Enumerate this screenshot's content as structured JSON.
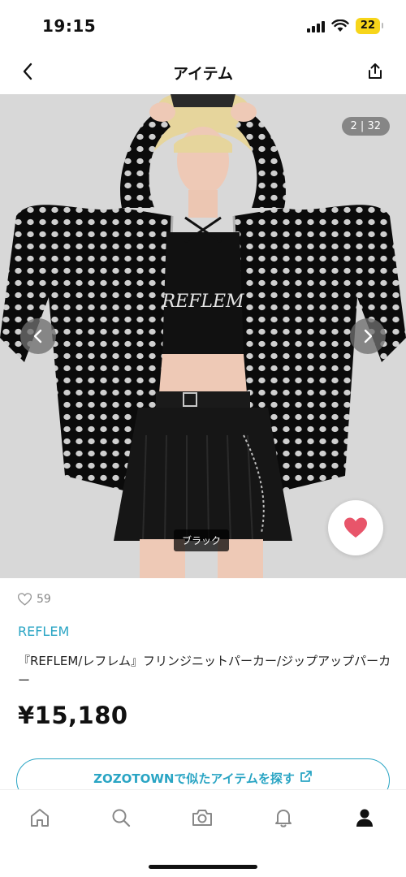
{
  "status_bar": {
    "time": "19:15",
    "battery": "22"
  },
  "nav": {
    "title": "アイテム",
    "back_icon": "chevron-left-icon",
    "share_icon": "share-icon"
  },
  "gallery": {
    "page_counter": "2 | 32",
    "color_label": "ブラック",
    "is_favorited": true
  },
  "item": {
    "likes": "59",
    "brand": "REFLEM",
    "name": "『REFLEM/レフレム』フリンジニットパーカー/ジップアップパーカー",
    "price": "¥15,180",
    "similar_button": "ZOZOTOWNで似たアイテムを探す"
  },
  "tabs": [
    {
      "name": "home",
      "icon": "home-icon"
    },
    {
      "name": "search",
      "icon": "search-icon"
    },
    {
      "name": "camera",
      "icon": "camera-icon"
    },
    {
      "name": "notifications",
      "icon": "bell-icon"
    },
    {
      "name": "profile",
      "icon": "person-icon",
      "active": true
    }
  ],
  "colors": {
    "accent": "#2aa5c4",
    "heart": "#e8556a",
    "text": "#111111",
    "muted": "#888888"
  }
}
